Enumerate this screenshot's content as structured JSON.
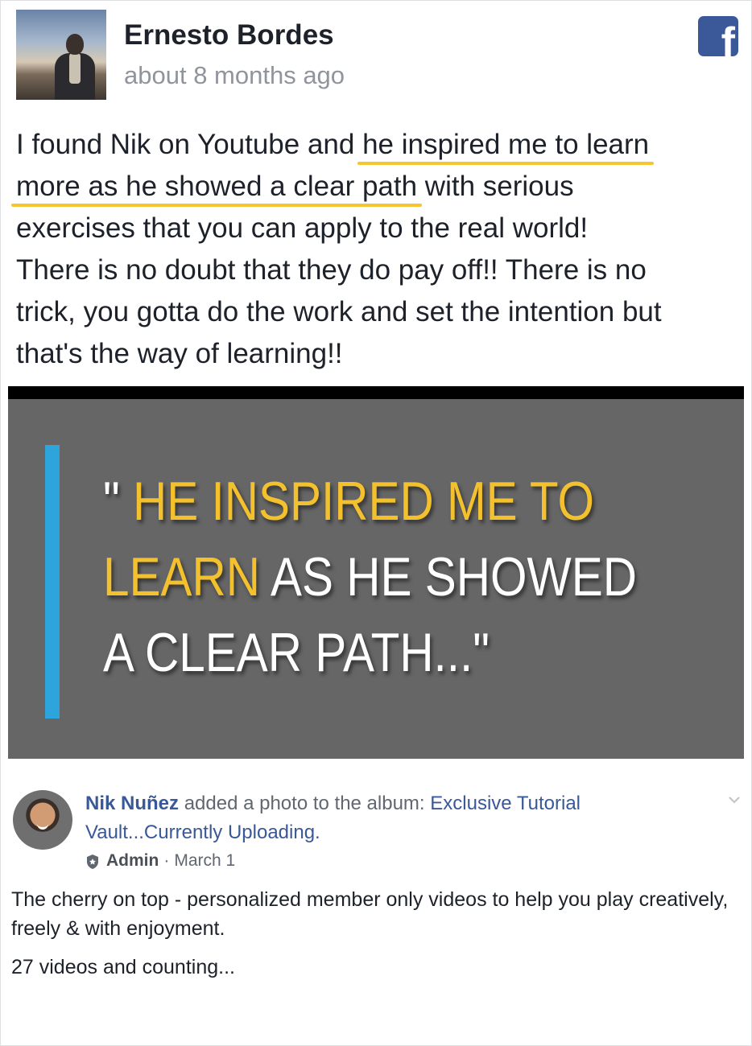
{
  "testimonial": {
    "author_name": "Ernesto Bordes",
    "timestamp": "about 8 months ago",
    "source_icon": "facebook-icon",
    "review_lines": [
      {
        "pre": "I found Nik on Youtube and ",
        "hl": "he inspired me to learn",
        "post": ""
      },
      {
        "pre": "",
        "hl": "more as he showed a clear path",
        "post": " with serious"
      },
      {
        "pre": "exercises that you can apply to the real world!",
        "hl": "",
        "post": ""
      },
      {
        "pre": "There is no doubt that they do pay off!! There is no",
        "hl": "",
        "post": ""
      },
      {
        "pre": "trick, you gotta do the work and set the intention but",
        "hl": "",
        "post": ""
      },
      {
        "pre": "that's the way of learning!!",
        "hl": "",
        "post": ""
      }
    ],
    "highlight_color": "#f7c52f"
  },
  "video": {
    "open_quote": "\"",
    "line1_gold": "HE INSPIRED ME TO",
    "line2_gold": "LEARN",
    "line2_white": "AS HE SHOWED",
    "line3_white": "A CLEAR PATH...\"",
    "accent_color": "#2ea4dc",
    "gold_color": "#f3c02e"
  },
  "post": {
    "author": "Nik Nuñez",
    "action": "added a photo to the album:",
    "album": "Exclusive Tutorial Vault...Currently Uploading.",
    "role": "Admin",
    "separator": "·",
    "date": "March 1",
    "body": "The cherry on top - personalized member only videos to help you play creatively, freely & with enjoyment.",
    "count_text": "27 videos and counting...",
    "link_color": "#385898"
  }
}
